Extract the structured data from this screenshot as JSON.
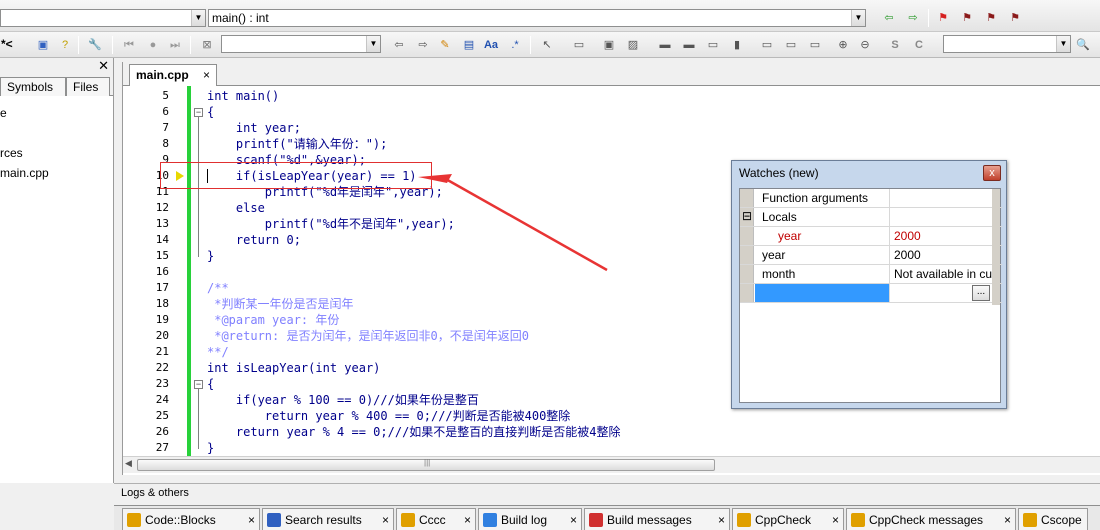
{
  "toolbar": {
    "scope_combo_value": "",
    "function_combo_value": "main() : int",
    "left_label": "*<",
    "search_combo_value": "",
    "right_combo_value": ""
  },
  "left_panel": {
    "tabs": [
      "Symbols",
      "Files"
    ],
    "tree_items": [
      "e",
      "rces",
      "main.cpp"
    ]
  },
  "editor": {
    "tab_label": "main.cpp",
    "close_glyph": "×",
    "lines": [
      {
        "no": "5",
        "code": "int main()"
      },
      {
        "no": "6",
        "code": "{"
      },
      {
        "no": "7",
        "code": "    int year;"
      },
      {
        "no": "8",
        "code": "    printf(\"请输入年份：\");"
      },
      {
        "no": "9",
        "code": "    scanf(\"%d\",&year);"
      },
      {
        "no": "10",
        "code": "    if(isLeapYear(year) == 1)"
      },
      {
        "no": "11",
        "code": "        printf(\"%d年是闰年\",year);"
      },
      {
        "no": "12",
        "code": "    else"
      },
      {
        "no": "13",
        "code": "        printf(\"%d年不是闰年\",year);"
      },
      {
        "no": "14",
        "code": "    return 0;"
      },
      {
        "no": "15",
        "code": "}"
      },
      {
        "no": "16",
        "code": ""
      },
      {
        "no": "17",
        "code": "/**"
      },
      {
        "no": "18",
        "code": " *判断某一年份是否是闰年"
      },
      {
        "no": "19",
        "code": " *@param year: 年份"
      },
      {
        "no": "20",
        "code": " *@return: 是否为闰年，是闰年返回非0，不是闰年返回0"
      },
      {
        "no": "21",
        "code": "**/"
      },
      {
        "no": "22",
        "code": "int isLeapYear(int year)"
      },
      {
        "no": "23",
        "code": "{"
      },
      {
        "no": "24",
        "code": "    if(year % 100 == 0)///如果年份是整百"
      },
      {
        "no": "25",
        "code": "        return year % 400 == 0;///判断是否能被400整除"
      },
      {
        "no": "26",
        "code": "    return year % 4 == 0;///如果不是整百的直接判断是否能被4整除"
      },
      {
        "no": "27",
        "code": "}"
      }
    ]
  },
  "watches": {
    "title": "Watches (new)",
    "close_glyph": "x",
    "rows": [
      {
        "name": "Function arguments",
        "value": ""
      },
      {
        "name": "Locals",
        "value": "",
        "expander": "⊟"
      },
      {
        "name": "year",
        "value": "2000",
        "changed": true
      },
      {
        "name": "year",
        "value": "2000"
      },
      {
        "name": "month",
        "value": "Not available in cu"
      },
      {
        "name": "",
        "value": "",
        "button": "..."
      }
    ]
  },
  "logs": {
    "title": "Logs & others",
    "tabs": [
      "Code::Blocks",
      "Search results",
      "Cccc",
      "Build log",
      "Build messages",
      "CppCheck",
      "CppCheck messages",
      "Cscope"
    ]
  }
}
